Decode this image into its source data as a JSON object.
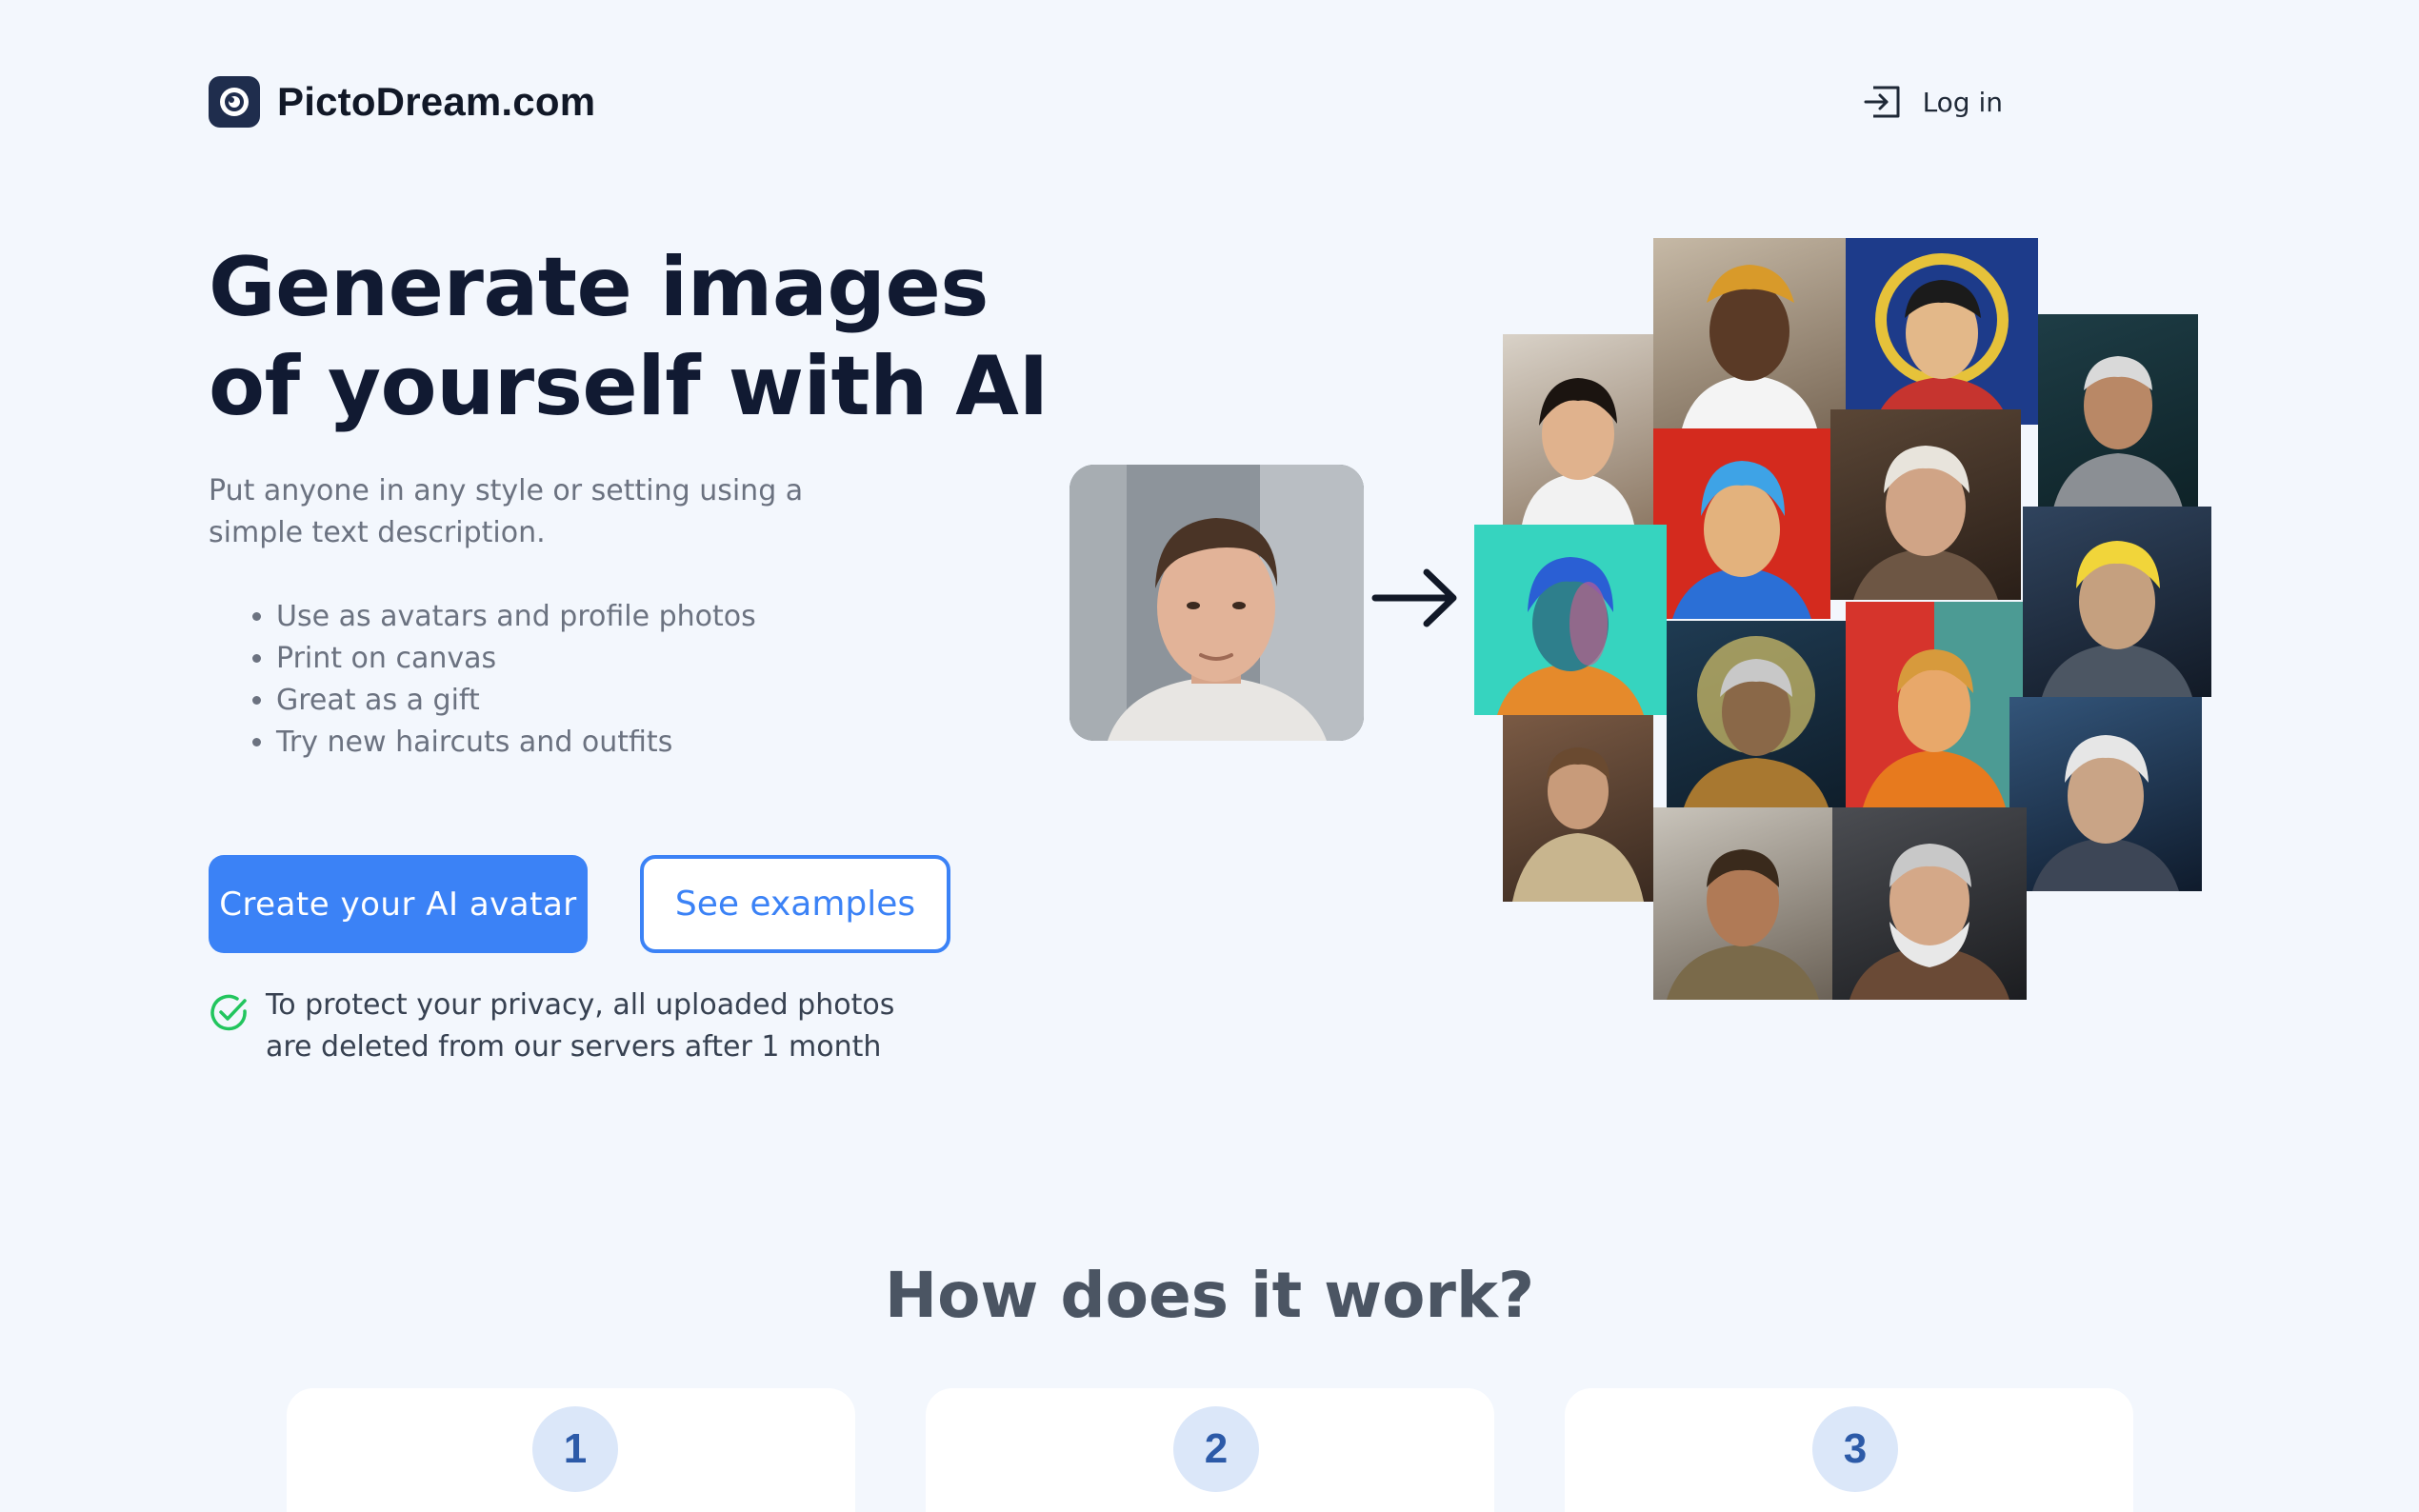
{
  "header": {
    "brand": "PictoDream.com",
    "login_label": "Log in"
  },
  "hero": {
    "title_line1": "Generate images",
    "title_line2": "of yourself with AI",
    "subtitle_line1": "Put anyone in any style or setting using a",
    "subtitle_line2": "simple text description.",
    "bullets": [
      "Use as avatars and profile photos",
      "Print on canvas",
      "Great as a gift",
      "Try new haircuts and outfits"
    ],
    "primary_button": "Create your AI avatar",
    "secondary_button": "See examples",
    "privacy_line1": "To protect your privacy, all uploaded photos",
    "privacy_line2": "are deleted from our servers after 1 month"
  },
  "how": {
    "title": "How does it work?",
    "steps": [
      "1",
      "2",
      "3"
    ]
  },
  "colors": {
    "background": "#f3f7fd",
    "accent": "#3b82f6",
    "check": "#22c55e"
  }
}
